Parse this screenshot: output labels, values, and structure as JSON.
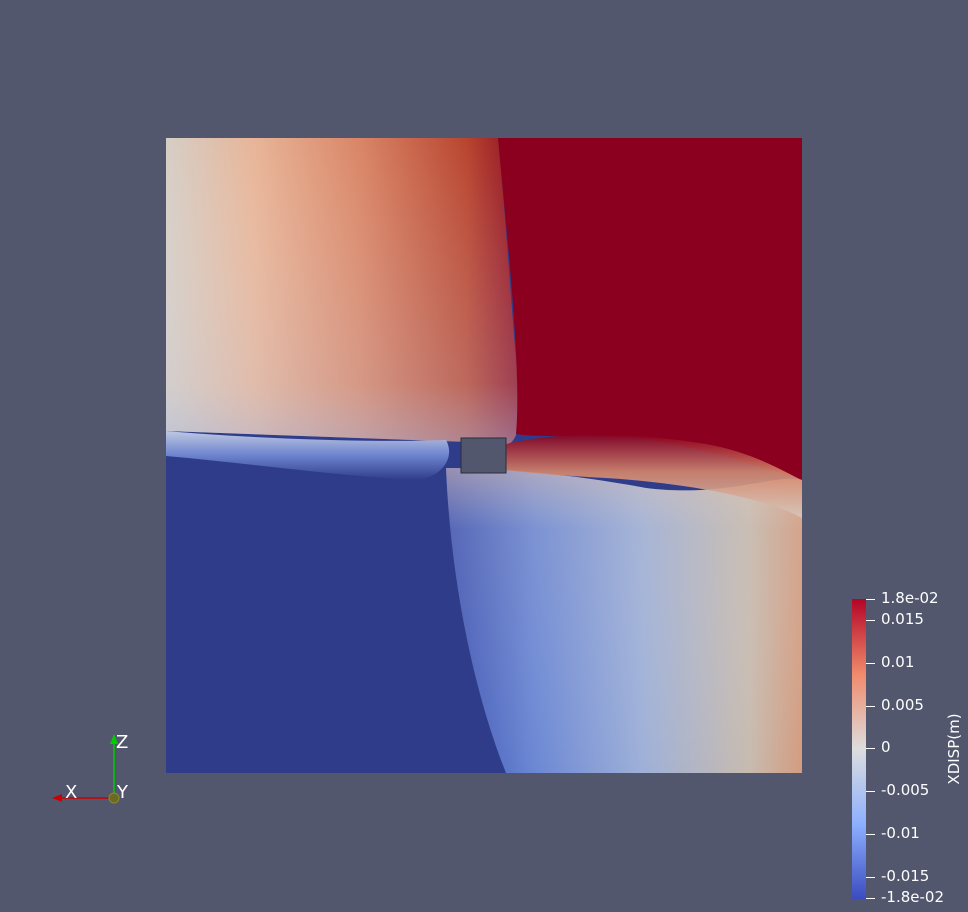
{
  "colorbar": {
    "title": "XDISP(m)",
    "max_label": "1.8e-02",
    "min_label": "-1.8e-02",
    "ticks": [
      "0.015",
      "0.01",
      "0.005",
      "0",
      "-0.005",
      "-0.01",
      "-0.015"
    ],
    "range": [
      -0.018,
      0.018
    ],
    "colormap": [
      "#3b4cc0",
      "#dddddd",
      "#b40426"
    ]
  },
  "axes": {
    "x_label": "X",
    "y_label": "Y",
    "z_label": "Z",
    "x_color": "#ff0000",
    "y_color": "#ffff00",
    "z_color": "#00ff00"
  },
  "colors": {
    "background": "#52576e",
    "field_max": "#8b001f",
    "field_min": "#2f3c8a",
    "hole_fill": "#52576e"
  }
}
